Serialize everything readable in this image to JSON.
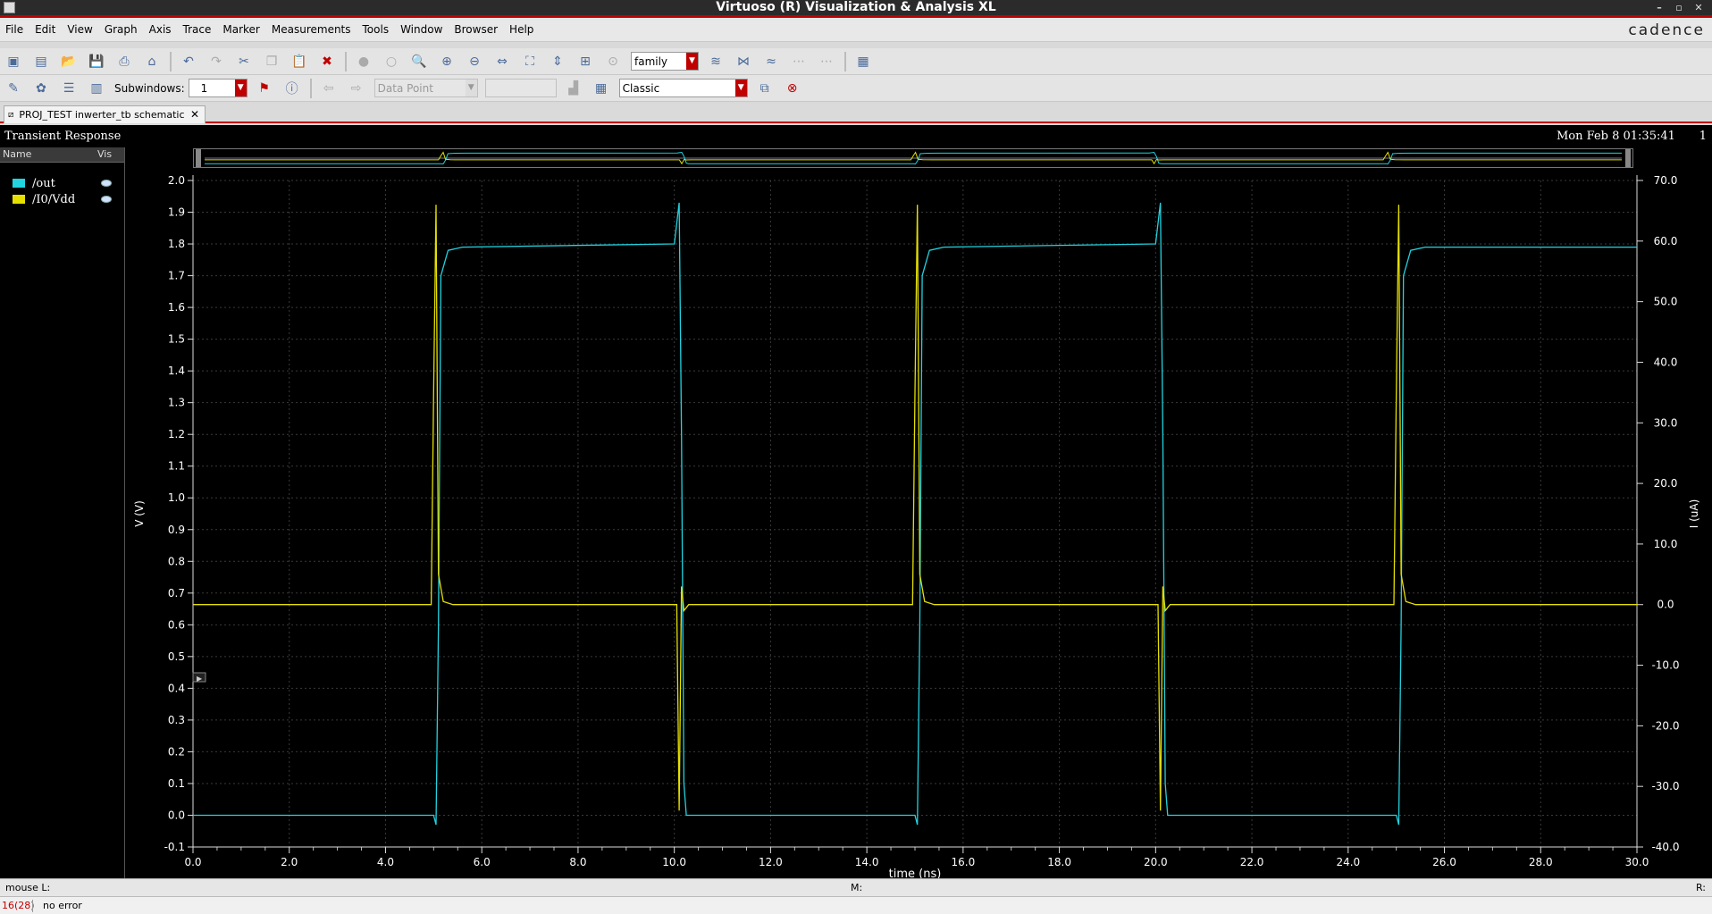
{
  "window": {
    "title": "Virtuoso (R) Visualization & Analysis XL",
    "brand": "cadence"
  },
  "menu": [
    "File",
    "Edit",
    "View",
    "Graph",
    "Axis",
    "Trace",
    "Marker",
    "Measurements",
    "Tools",
    "Window",
    "Browser",
    "Help"
  ],
  "toolbar": {
    "family_combo": "family",
    "subwindows_label": "Subwindows:",
    "subwindows_value": "1",
    "datapoint_combo": "Data Point",
    "style_combo": "Classic"
  },
  "tab": {
    "label": "PROJ_TEST inwerter_tb schematic"
  },
  "plot": {
    "title": "Transient Response",
    "datetime": "Mon Feb 8 01:35:41",
    "subwindow_number": "1"
  },
  "legend": {
    "name_header": "Name",
    "vis_header": "Vis",
    "items": [
      {
        "name": "/out",
        "color": "#22d3e0"
      },
      {
        "name": "/I0/Vdd",
        "color": "#e5e000"
      }
    ]
  },
  "status": {
    "mouse_l": "mouse L:",
    "mouse_m": "M:",
    "mouse_r": "R:",
    "count": "16(28)",
    "message": "no error"
  },
  "chart_data": {
    "type": "line",
    "xlabel": "time (ns)",
    "ylabel": "V (V)",
    "y2label": "I (uA)",
    "xlim": [
      0,
      30
    ],
    "ylim": [
      -0.1,
      2.0
    ],
    "y2lim": [
      -40,
      70
    ],
    "xticks": [
      "0.0",
      "2.0",
      "4.0",
      "6.0",
      "8.0",
      "10.0",
      "12.0",
      "14.0",
      "16.0",
      "18.0",
      "20.0",
      "22.0",
      "24.0",
      "26.0",
      "28.0",
      "30.0"
    ],
    "yticks": [
      "2.0",
      "1.9",
      "1.8",
      "1.7",
      "1.6",
      "1.5",
      "1.4",
      "1.3",
      "1.2",
      "1.1",
      "1.0",
      "0.9",
      "0.8",
      "0.7",
      "0.6",
      "0.5",
      "0.4",
      "0.3",
      "0.2",
      "0.1",
      "0.0",
      "-0.1"
    ],
    "y2ticks": [
      "70.0",
      "60.0",
      "50.0",
      "40.0",
      "30.0",
      "20.0",
      "10.0",
      "0.0",
      "-10.0",
      "-20.0",
      "-30.0",
      "-40.0"
    ],
    "grid": true,
    "series": [
      {
        "name": "/out",
        "axis": "left",
        "color": "#22d3e0",
        "x": [
          0,
          5.0,
          5.05,
          5.1,
          5.15,
          5.3,
          5.6,
          10.0,
          10.1,
          10.15,
          10.2,
          10.25,
          15.0,
          15.05,
          15.1,
          15.15,
          15.3,
          15.6,
          20.0,
          20.1,
          20.15,
          20.2,
          20.25,
          25.0,
          25.05,
          25.1,
          25.15,
          25.3,
          25.6,
          30.0
        ],
        "y": [
          0.0,
          0.0,
          -0.03,
          0.6,
          1.7,
          1.78,
          1.79,
          1.8,
          1.93,
          1.2,
          0.1,
          0.0,
          0.0,
          -0.03,
          0.6,
          1.7,
          1.78,
          1.79,
          1.8,
          1.93,
          1.2,
          0.1,
          0.0,
          0.0,
          -0.03,
          0.6,
          1.7,
          1.78,
          1.79,
          1.79
        ]
      },
      {
        "name": "/I0/Vdd",
        "axis": "right",
        "color": "#e5e000",
        "x": [
          0,
          4.95,
          5.0,
          5.05,
          5.1,
          5.2,
          5.4,
          10.05,
          10.1,
          10.15,
          10.2,
          10.3,
          14.95,
          15.0,
          15.05,
          15.1,
          15.2,
          15.4,
          20.05,
          20.1,
          20.15,
          20.2,
          20.3,
          24.95,
          25.0,
          25.05,
          25.1,
          25.2,
          25.4,
          30.0
        ],
        "y": [
          0.0,
          0.0,
          35.0,
          66.0,
          5.0,
          0.5,
          0.0,
          0.0,
          -34.0,
          3.0,
          -1.0,
          0.0,
          0.0,
          35.0,
          66.0,
          5.0,
          0.5,
          0.0,
          0.0,
          -34.0,
          3.0,
          -1.0,
          0.0,
          0.0,
          35.0,
          66.0,
          5.0,
          0.5,
          0.0,
          0.0
        ]
      }
    ]
  }
}
